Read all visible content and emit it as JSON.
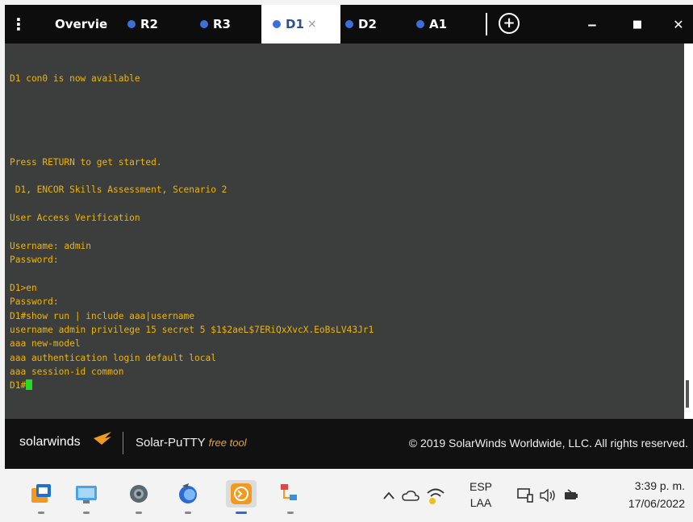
{
  "tabs": [
    {
      "label": "Overvie",
      "dot": false,
      "active": false
    },
    {
      "label": "R2",
      "dot": true,
      "active": false
    },
    {
      "label": "R3",
      "dot": true,
      "active": false
    },
    {
      "label": "D1",
      "dot": true,
      "active": true,
      "close": "×"
    },
    {
      "label": "D2",
      "dot": true,
      "active": false
    },
    {
      "label": "A1",
      "dot": true,
      "active": false
    }
  ],
  "tabbar": {
    "menu_glyph": "⋮",
    "new_tab_glyph": "+",
    "minimize_glyph": "‒",
    "maximize_glyph": "■",
    "close_glyph": "✕"
  },
  "terminal": {
    "lines": [
      "",
      "",
      "D1 con0 is now available",
      "",
      "",
      "",
      "",
      "",
      "Press RETURN to get started.",
      "",
      " D1, ENCOR Skills Assessment, Scenario 2",
      "",
      "User Access Verification",
      "",
      "Username: admin",
      "Password:",
      "",
      "D1>en",
      "Password:",
      "D1#show run | include aaa|username",
      "username admin privilege 15 secret 5 $1$2aeL$7ERiQxXvcX.EoBsLV43Jr1",
      "aaa new-model",
      "aaa authentication login default local",
      "aaa session-id common"
    ],
    "prompt": "D1#",
    "text_color": "#f0b400",
    "cursor_color": "#22dd22",
    "background": "#3b3e3c"
  },
  "footer": {
    "brand": "solarwinds",
    "product": "Solar-PuTTY",
    "product_tag": "free tool",
    "copyright": "© 2019 SolarWinds Worldwide, LLC. All rights reserved."
  },
  "taskbar": {
    "apps": [
      "task-view-icon",
      "remote-desktop-icon",
      "settings-gear-icon",
      "eclipse-browser-icon",
      "solar-putty-icon",
      "network-diagram-icon"
    ],
    "lang_top": "ESP",
    "lang_bottom": "LAA",
    "time": "3:39 p. m.",
    "date": "17/06/2022"
  }
}
